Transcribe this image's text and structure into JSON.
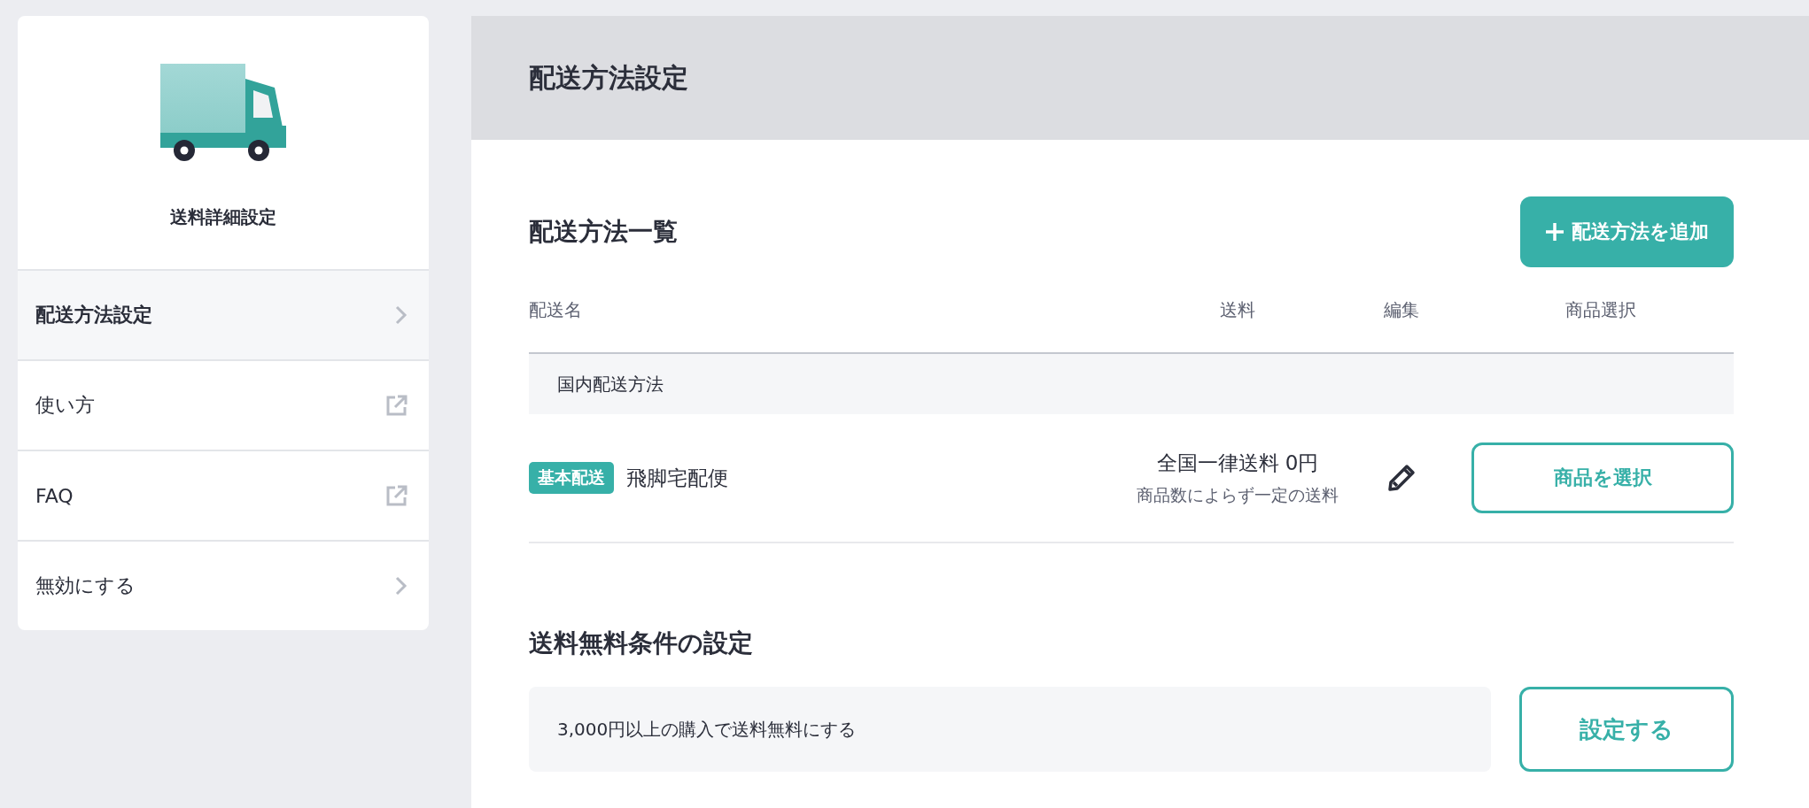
{
  "sidebar": {
    "title": "送料詳細設定",
    "items": [
      {
        "label": "配送方法設定",
        "kind": "chevron",
        "selected": true
      },
      {
        "label": "使い方",
        "kind": "external",
        "selected": false
      },
      {
        "label": "FAQ",
        "kind": "external",
        "selected": false
      },
      {
        "label": "無効にする",
        "kind": "chevron",
        "selected": false
      }
    ]
  },
  "page": {
    "title": "配送方法設定"
  },
  "shipping_list": {
    "title": "配送方法一覧",
    "add_button": "配送方法を追加",
    "columns": [
      "配送名",
      "送料",
      "編集",
      "商品選択"
    ],
    "groups": [
      {
        "name": "国内配送方法",
        "rows": [
          {
            "badge": "基本配送",
            "name": "飛脚宅配便",
            "fee": "全国一律送料 0円",
            "fee_note": "商品数によらず一定の送料",
            "select_button": "商品を選択"
          }
        ]
      }
    ]
  },
  "free_shipping": {
    "title": "送料無料条件の設定",
    "condition": "3,000円以上の購入で送料無料にする",
    "button": "設定する"
  }
}
